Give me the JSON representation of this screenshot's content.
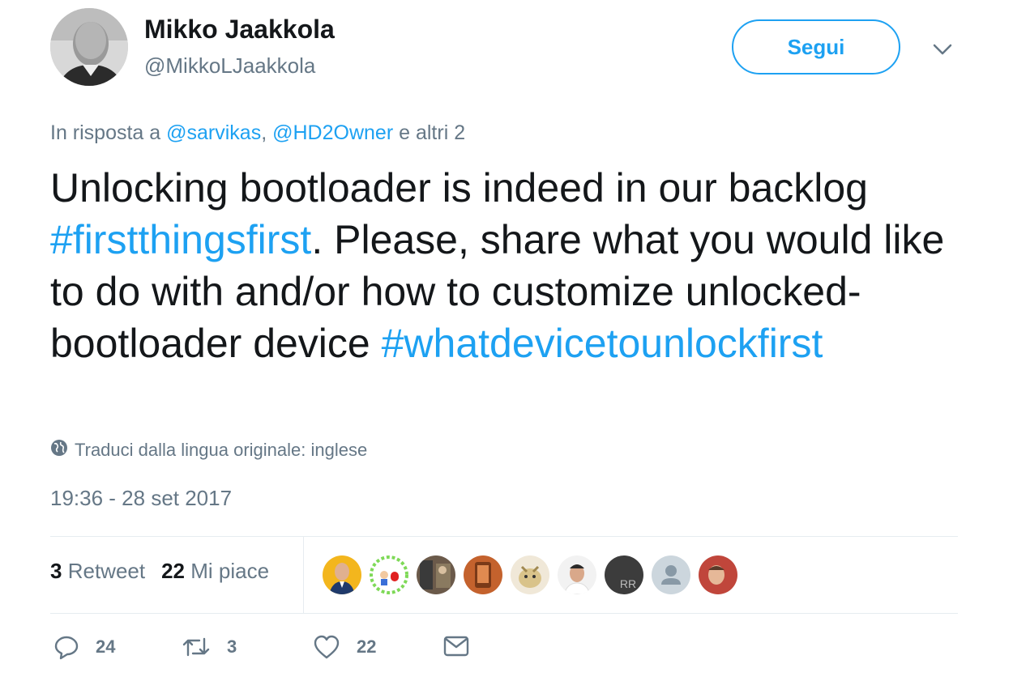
{
  "user": {
    "name": "Mikko Jaakkola",
    "handle": "@MikkoLJaakkola",
    "follow_label": "Segui"
  },
  "reply": {
    "prefix": "In risposta a",
    "mention1": "@sarvikas",
    "comma": ",",
    "mention2": "@HD2Owner",
    "suffix": "e altri 2"
  },
  "tweet": {
    "part1": "Unlocking bootloader is indeed in our backlog ",
    "hashtag1": "#firstthingsfirst",
    "part2": ". Please, share what you would like to do with and/or how to customize unlocked-bootloader device ",
    "hashtag2": "#whatdevicetounlockfirst"
  },
  "translate_label": "Traduci dalla lingua originale: inglese",
  "timestamp": "19:36 - 28 set 2017",
  "stats": {
    "retweets_count": "3",
    "retweets_label": "Retweet",
    "likes_count": "22",
    "likes_label": "Mi piace"
  },
  "likers": [
    {
      "icon": "avatar-man-suit",
      "bg": "#f3b61d"
    },
    {
      "icon": "avatar-cartoon",
      "bg": "#7ed957"
    },
    {
      "icon": "avatar-photo",
      "bg": "#6b5a4a"
    },
    {
      "icon": "avatar-phone",
      "bg": "#c4622d"
    },
    {
      "icon": "avatar-dog",
      "bg": "#d9c38a"
    },
    {
      "icon": "avatar-man",
      "bg": "#e8d6c8"
    },
    {
      "icon": "avatar-initials",
      "bg": "#3c3c3c",
      "initials": "RR"
    },
    {
      "icon": "avatar-default",
      "bg": "#ccd6dd"
    },
    {
      "icon": "avatar-man-red",
      "bg": "#c0463b"
    }
  ],
  "actions": {
    "reply_count": "24",
    "retweet_count": "3",
    "like_count": "22"
  }
}
